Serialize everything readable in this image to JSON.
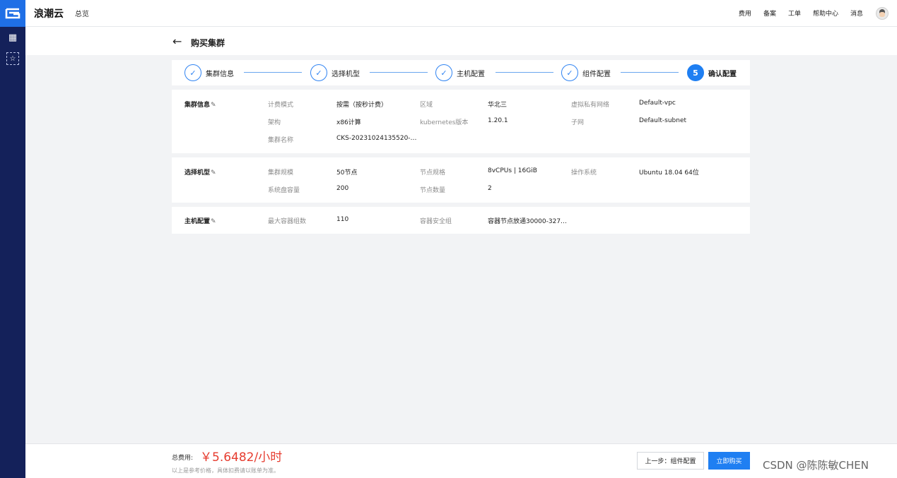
{
  "sidebar": {
    "logo_icon": "inspur-cloud-logo-icon",
    "items": [
      {
        "icon": "grid-apps-icon",
        "glyph": "▦"
      },
      {
        "icon": "star-favorite-icon",
        "glyph": "☆"
      }
    ]
  },
  "topbar": {
    "brand": "浪潮云",
    "overview": "总览",
    "nav": [
      "费用",
      "备案",
      "工单",
      "帮助中心",
      "消息"
    ]
  },
  "page": {
    "back_glyph": "←",
    "title": "购买集群"
  },
  "steps": [
    {
      "label": "集群信息",
      "state": "done",
      "glyph": "✓"
    },
    {
      "label": "选择机型",
      "state": "done",
      "glyph": "✓"
    },
    {
      "label": "主机配置",
      "state": "done",
      "glyph": "✓"
    },
    {
      "label": "组件配置",
      "state": "done",
      "glyph": "✓"
    },
    {
      "label": "确认配置",
      "state": "active",
      "glyph": "5"
    }
  ],
  "sections": {
    "cluster_info": {
      "title": "集群信息",
      "edit_glyph": "✎",
      "fields": [
        {
          "label": "计费模式",
          "value": "按需（按秒计费）"
        },
        {
          "label": "区域",
          "value": "华北三"
        },
        {
          "label": "虚拟私有网络",
          "value": "Default-vpc"
        },
        {
          "label": "架构",
          "value": "x86计算"
        },
        {
          "label": "kubernetes版本",
          "value": "1.20.1"
        },
        {
          "label": "子网",
          "value": "Default-subnet"
        },
        {
          "label": "集群名称",
          "value": "CKS-20231024135520-…"
        }
      ]
    },
    "machine_type": {
      "title": "选择机型",
      "edit_glyph": "✎",
      "fields": [
        {
          "label": "集群规模",
          "value": "50节点"
        },
        {
          "label": "节点规格",
          "value": "8vCPUs | 16GiB"
        },
        {
          "label": "操作系统",
          "value": "Ubuntu 18.04 64位"
        },
        {
          "label": "系统盘容量",
          "value": "200"
        },
        {
          "label": "节点数量",
          "value": "2"
        }
      ]
    },
    "host_config": {
      "title": "主机配置",
      "edit_glyph": "✎",
      "fields": [
        {
          "label": "最大容器组数",
          "value": "110"
        },
        {
          "label": "容器安全组",
          "value": "容器节点放通30000-327…"
        }
      ]
    }
  },
  "footer": {
    "cost_label": "总费用:",
    "cost_value": "￥5.6482/小时",
    "cost_note": "以上是参考价格，具体扣费请以账单为准。",
    "prev_label": "上一步：组件配置",
    "buy_label": "立即购买"
  },
  "watermark": "CSDN @陈陈敏CHEN",
  "colors": {
    "accent": "#1f7ff2",
    "sidebar": "#14215a",
    "price": "#e63c2f"
  }
}
